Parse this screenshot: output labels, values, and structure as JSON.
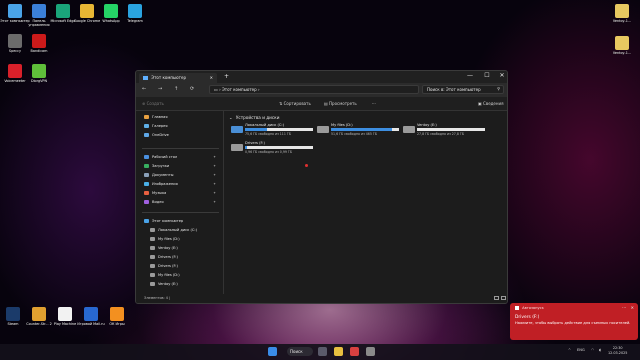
{
  "desktop": {
    "icons_left": [
      {
        "label": "Этот компьютер",
        "color": "#4aa3e8"
      },
      {
        "label": "Панель управления",
        "color": "#3b7fd8"
      },
      {
        "label": "Microsoft Edge",
        "color": "#1aa57a"
      },
      {
        "label": "Google Chrome",
        "color": "#e8b634"
      },
      {
        "label": "WhatsApp",
        "color": "#25d366"
      },
      {
        "label": "Telegram",
        "color": "#2aa3e0"
      },
      {
        "label": "Speccy",
        "color": "#6b6b6b"
      },
      {
        "label": "Bandicam",
        "color": "#cc1a1a"
      },
      {
        "label": "Voicemeeter",
        "color": "#d8202a"
      },
      {
        "label": "DiorgVPN",
        "color": "#5fbf3a"
      }
    ],
    "icons_right": [
      {
        "label": "Ventoy-1...",
        "color": "#e8c860"
      },
      {
        "label": "Ventoy-1...",
        "color": "#e8c860"
      }
    ],
    "icons_bottom": [
      {
        "label": "Steam",
        "color": "#1b3b6a"
      },
      {
        "label": "Counter-Str... 2",
        "color": "#e0a030"
      },
      {
        "label": "Play Machine",
        "color": "#f2f2f2"
      },
      {
        "label": "Игровой Mail.ru",
        "color": "#2868d0"
      },
      {
        "label": "ОК Игры",
        "color": "#f39020"
      }
    ]
  },
  "explorer": {
    "tab_title": "Этот компьютер",
    "new_tab": "+",
    "window_controls": {
      "minimize": "—",
      "maximize": "☐",
      "close": "✕"
    },
    "nav": {
      "back": "←",
      "forward": "→",
      "up": "↑",
      "refresh": "⟳",
      "monitor": "▭",
      "sep": "›"
    },
    "address": "Этот компьютер",
    "address_chevron": "›",
    "search_placeholder": "Поиск в: Этот компьютер",
    "search_icon": "⚲",
    "toolbar": {
      "create": "⊕ Создать",
      "sort": "⇅ Сортировать",
      "view": "▤ Просмотреть",
      "more": "···",
      "details": "▣ Сведения"
    },
    "sidebar": {
      "items": [
        {
          "label": "Главная",
          "color": "#e8a040",
          "pin": ""
        },
        {
          "label": "Галерея",
          "color": "#5fb0e8",
          "pin": ""
        },
        {
          "label": "OneDrive",
          "color": "#5fa8e8",
          "pin": ""
        },
        {
          "label": "Рабочий стол",
          "color": "#4a90e0",
          "pin": "✦"
        },
        {
          "label": "Загрузки",
          "color": "#38b060",
          "pin": "✦"
        },
        {
          "label": "Документы",
          "color": "#8aa0b8",
          "pin": "✦"
        },
        {
          "label": "Изображения",
          "color": "#4ab0e8",
          "pin": "✦"
        },
        {
          "label": "Музыка",
          "color": "#e86040",
          "pin": "✦"
        },
        {
          "label": "Видео",
          "color": "#a060e0",
          "pin": "✦"
        },
        {
          "label": "Этот компьютер",
          "color": "#4aa3e8",
          "pin": ""
        },
        {
          "label": "Локальный диск (C:)",
          "color": "#9a9a9a",
          "pin": ""
        },
        {
          "label": "My files (D:)",
          "color": "#9a9a9a",
          "pin": ""
        },
        {
          "label": "Ventoy (E:)",
          "color": "#9a9a9a",
          "pin": ""
        },
        {
          "label": "Drivers (F:)",
          "color": "#9a9a9a",
          "pin": ""
        },
        {
          "label": "Drivers (F:)",
          "color": "#9a9a9a",
          "pin": ""
        },
        {
          "label": "My files (D:)",
          "color": "#9a9a9a",
          "pin": ""
        },
        {
          "label": "Ventoy (E:)",
          "color": "#9a9a9a",
          "pin": ""
        }
      ]
    },
    "section_title": "Устройства и диски",
    "drives": [
      {
        "name": "Локальный диск (C:)",
        "info": "75,6 ГБ свободно из 111 ГБ",
        "used_fraction": 0.32,
        "windows": true
      },
      {
        "name": "My files (D:)",
        "info": "51,6 ГБ свободно из 465 ГБ",
        "used_fraction": 0.89,
        "windows": false
      },
      {
        "name": "Ventoy (E:)",
        "info": "27,8 ГБ свободно из 27,8 ГБ",
        "used_fraction": 0.0,
        "windows": false
      },
      {
        "name": "Drivers (F:)",
        "info": "0,96 ГБ свободно из 0,99 ГБ",
        "used_fraction": 0.03,
        "windows": false
      }
    ],
    "status": "Элементов: 4",
    "status_sep": "|"
  },
  "taskbar": {
    "search_label": "Поиск",
    "tray": {
      "chevron": "^",
      "lang": "ENG",
      "wifi": "◠",
      "volume": "◖"
    },
    "time": "22:30",
    "date": "12.03.2025"
  },
  "notification": {
    "app": "Автозапуск",
    "title": "Drivers (F:)",
    "body": "Нажмите, чтобы выбрать действие для съемных носителей.",
    "more": "···",
    "close": "✕"
  }
}
